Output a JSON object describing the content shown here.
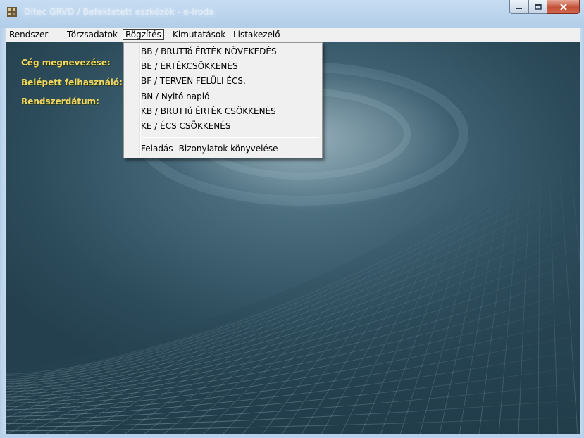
{
  "window": {
    "title": "Ditec GRVD / Befektetett eszközök - e-Iroda",
    "controls": {
      "minimize": "minimize",
      "maximize": "maximize",
      "close": "close"
    }
  },
  "menubar": {
    "items": [
      {
        "label": "Rendszer"
      },
      {
        "label": "Törzsadatok"
      },
      {
        "label": "Rögzítés",
        "active": true
      },
      {
        "label": "Kimutatások"
      },
      {
        "label": "Listakezelő"
      }
    ]
  },
  "dropdown": {
    "items": [
      {
        "label": "BB / BRUTTó ÉRTÉK NÖVEKEDÉS"
      },
      {
        "label": "BE / ÉRTÉKCSÖKKENÉS"
      },
      {
        "label": "BF / TERVEN FELÜLI ÉCS."
      },
      {
        "label": "BN / Nyitó napló"
      },
      {
        "label": "KB / BRUTTú ÉRTÉK CSÖKKENÉS"
      },
      {
        "label": "KE / ÉCS CSÖKKENÉS"
      }
    ],
    "footer_item": {
      "label": "Feladás- Bizonylatok könyvelése"
    }
  },
  "info": {
    "company_label": "Cég megnevezése:",
    "user_label": "Belépett felhasználó:",
    "date_label": "Rendszerdátum:"
  },
  "colors": {
    "info_text": "#f2d860",
    "background_dark": "#24404e",
    "menu_bg": "#f0f0f0"
  },
  "icons": {
    "app": "app-logo-icon",
    "minimize": "minimize-icon",
    "maximize": "maximize-icon",
    "close": "close-icon"
  }
}
